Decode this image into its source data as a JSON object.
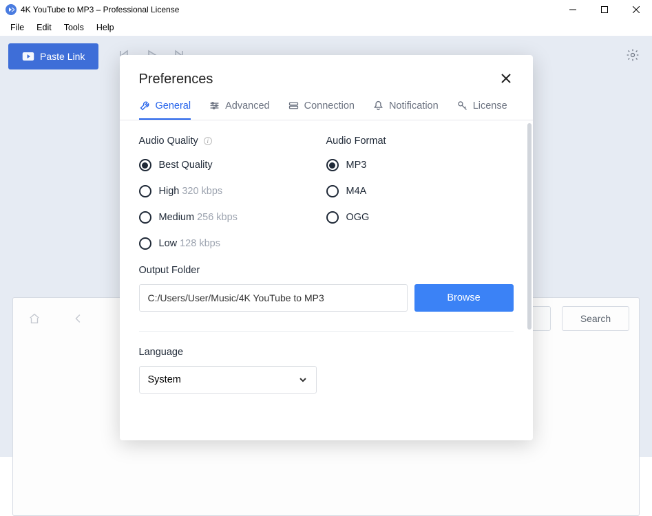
{
  "window": {
    "title": "4K YouTube to MP3 – Professional License"
  },
  "menu": {
    "file": "File",
    "edit": "Edit",
    "tools": "Tools",
    "help": "Help"
  },
  "toolbar": {
    "paste_link": "Paste Link"
  },
  "background": {
    "search_btn": "Search"
  },
  "modal": {
    "title": "Preferences",
    "tabs": {
      "general": "General",
      "advanced": "Advanced",
      "connection": "Connection",
      "notification": "Notification",
      "license": "License"
    },
    "audio_quality": {
      "label": "Audio Quality",
      "best": "Best Quality",
      "high": "High",
      "high_rate": "320 kbps",
      "medium": "Medium",
      "medium_rate": "256 kbps",
      "low": "Low",
      "low_rate": "128 kbps"
    },
    "audio_format": {
      "label": "Audio Format",
      "mp3": "MP3",
      "m4a": "M4A",
      "ogg": "OGG"
    },
    "output": {
      "label": "Output Folder",
      "path": "C:/Users/User/Music/4K YouTube to MP3",
      "browse": "Browse"
    },
    "language": {
      "label": "Language",
      "value": "System"
    }
  }
}
